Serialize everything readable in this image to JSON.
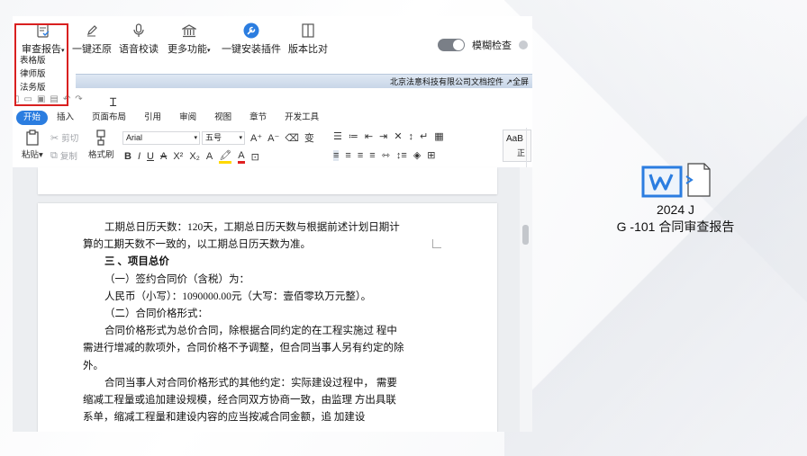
{
  "toolbar": {
    "contract_review": "审查报告",
    "restore": "一键还原",
    "voice_proofread": "语音校读",
    "more_features": "更多功能",
    "install_plugin": "一键安装插件",
    "version_compare": "版本比对",
    "fuzzy_check": "模糊检查"
  },
  "dropdown": {
    "items": [
      "表格版",
      "律师版",
      "法务版"
    ]
  },
  "title_strip": "北京法意科技有限公司文档控件 ↗全屏",
  "ribbon_tabs": [
    "开始",
    "插入",
    "页面布局",
    "引用",
    "审阅",
    "视图",
    "章节",
    "开发工具"
  ],
  "ribbon": {
    "paste": "粘贴",
    "cut": "剪切",
    "copy": "复制",
    "format_painter": "格式刷",
    "font_name": "Arial",
    "font_size": "五号",
    "style_preview": "AaB",
    "style_label": "正"
  },
  "document": {
    "lines": [
      {
        "text": "工期总日历天数：120天，工期总日历天数与根据前述计划日期计算的工期天数不一致的，以工期总日历天数为准。",
        "indent": true
      },
      {
        "text": "三 、项目总价",
        "indent": true
      },
      {
        "text": "（一）签约合同价（含税）为：",
        "indent": true
      },
      {
        "text": "人民币（小写）：1090000.00元（大写：壹佰零玖万元整）。",
        "indent": true
      },
      {
        "text": "（二）合同价格形式：",
        "indent": true
      },
      {
        "text": "合同价格形式为总价合同，除根据合同约定的在工程实施过 程中需进行增减的款项外，合同价格不予调整，但合同当事人另有约定的除外。",
        "indent": true
      },
      {
        "text": "合同当事人对合同价格形式的其他约定：实际建设过程中， 需要缩减工程量或追加建设规模，经合同双方协商一致，由监理 方出具联系单，缩减工程量和建设内容的应当按减合同金额，追 加建设",
        "indent": true
      }
    ]
  },
  "desktop_file": {
    "line1": "2024 J",
    "line2": "G -101 合同审查报告",
    "icon": "word-document-icon",
    "accent": "#2b7de0"
  }
}
